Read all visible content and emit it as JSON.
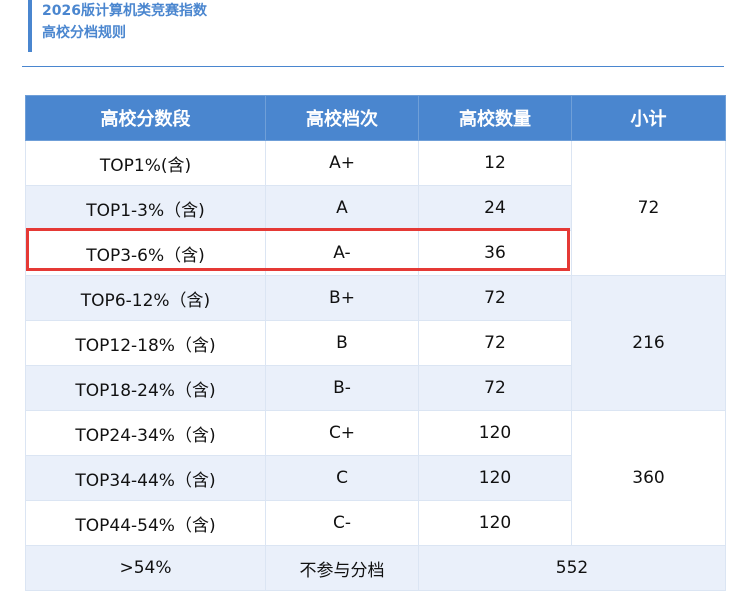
{
  "header": {
    "line1": "2026版计算机类竞赛指数",
    "line2": "高校分档规则"
  },
  "table": {
    "headers": [
      "高校分数段",
      "高校档次",
      "高校数量",
      "小计"
    ],
    "rows": [
      {
        "range": "TOP1%(含)",
        "grade": "A+",
        "count": "12"
      },
      {
        "range": "TOP1-3%（含)",
        "grade": "A",
        "count": "24"
      },
      {
        "range": "TOP3-6%（含)",
        "grade": "A-",
        "count": "36"
      },
      {
        "range": "TOP6-12%（含)",
        "grade": "B+",
        "count": "72"
      },
      {
        "range": "TOP12-18%（含)",
        "grade": "B",
        "count": "72"
      },
      {
        "range": "TOP18-24%（含)",
        "grade": "B-",
        "count": "72"
      },
      {
        "range": "TOP24-34%（含)",
        "grade": "C+",
        "count": "120"
      },
      {
        "range": "TOP34-44%（含)",
        "grade": "C",
        "count": "120"
      },
      {
        "range": "TOP44-54%（含)",
        "grade": "C-",
        "count": "120"
      }
    ],
    "subtotals": [
      "72",
      "216",
      "360"
    ],
    "last_row": {
      "range": ">54%",
      "grade": "不参与分档",
      "count": "552"
    }
  },
  "colors": {
    "accent": "#4a86cf",
    "highlight": "#e53935",
    "row_alt": "#eaf0fa"
  }
}
